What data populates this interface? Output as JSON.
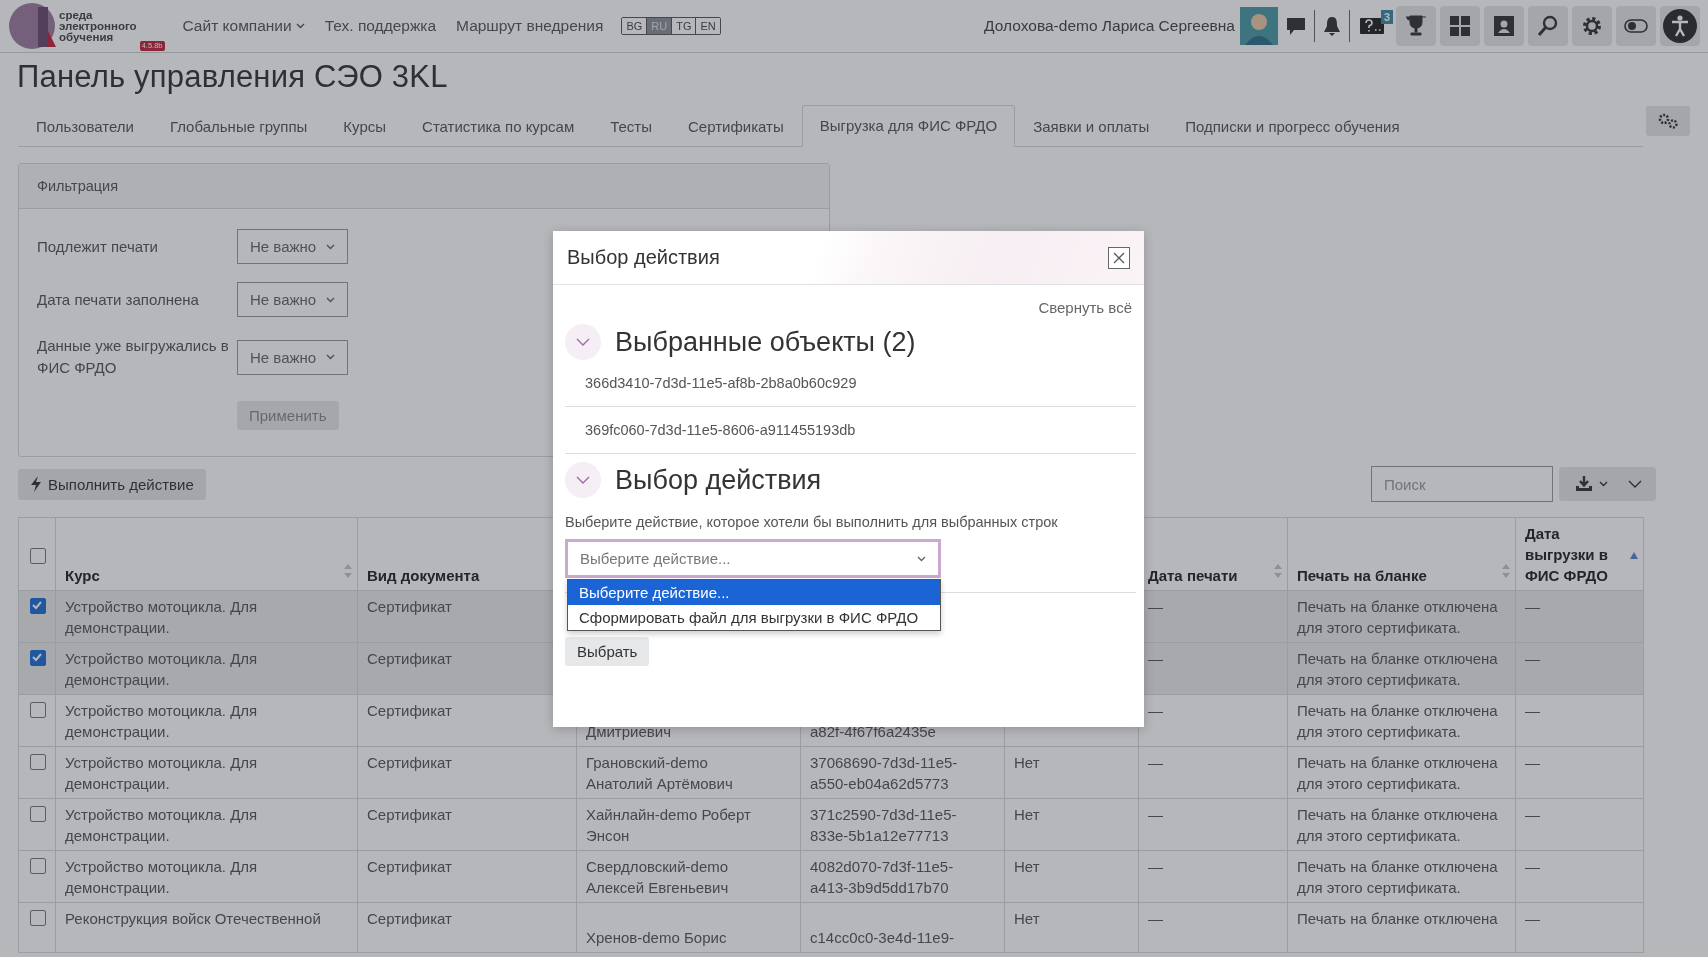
{
  "header": {
    "logo_lines": [
      "среда",
      "электронного",
      "обучения"
    ],
    "version": "4.5.8b",
    "nav": [
      {
        "label": "Сайт компании",
        "has_menu": true
      },
      {
        "label": "Тех. поддержка",
        "has_menu": false
      },
      {
        "label": "Маршрут внедрения",
        "has_menu": false
      }
    ],
    "languages": [
      {
        "label": "BG",
        "selected": false
      },
      {
        "label": "RU",
        "selected": true
      },
      {
        "label": "TG",
        "selected": false
      },
      {
        "label": "EN",
        "selected": false
      }
    ],
    "user_name": "Долохова-demo Лариса Сергеевна",
    "help_badge": "3"
  },
  "page_title": "Панель управления СЭО 3KL",
  "tabs": [
    {
      "label": "Пользователи",
      "selected": false
    },
    {
      "label": "Глобальные группы",
      "selected": false
    },
    {
      "label": "Курсы",
      "selected": false
    },
    {
      "label": "Статистика по курсам",
      "selected": false
    },
    {
      "label": "Тесты",
      "selected": false
    },
    {
      "label": "Сертификаты",
      "selected": false
    },
    {
      "label": "Выгрузка для ФИС ФРДО",
      "selected": true
    },
    {
      "label": "Заявки и оплаты",
      "selected": false
    },
    {
      "label": "Подписки и прогресс обучения",
      "selected": false
    }
  ],
  "filter": {
    "title": "Фильтрация",
    "fields": [
      {
        "label": "Подлежит печати",
        "value": "Не важно"
      },
      {
        "label": "Дата печати заполнена",
        "value": "Не важно"
      },
      {
        "label": "Данные уже выгружались в ФИС ФРДО",
        "value": "Не важно"
      }
    ],
    "apply": "Применить"
  },
  "toolbar": {
    "action": "Выполнить действие",
    "search_placeholder": "Поиск"
  },
  "table": {
    "select_all": {
      "checked": false
    },
    "columns": [
      {
        "label": "Курс",
        "sortable": true,
        "sorted": false
      },
      {
        "label": "Вид документа",
        "sortable": false
      },
      null,
      null,
      null,
      {
        "label": "Дата печати",
        "sortable": true,
        "sorted": false
      },
      {
        "label": "Печать на бланке",
        "sortable": true,
        "sorted": false
      },
      {
        "label": "Дата выгрузки в ФИС ФРДО",
        "sortable": true,
        "sorted": true
      }
    ],
    "rows": [
      {
        "checked": true,
        "cells": [
          "Устройство мотоцикла. Для демонстрации.",
          "Сертификат",
          null,
          null,
          null,
          "—",
          "Печать на бланке отключена для этого сертификата.",
          "—"
        ]
      },
      {
        "checked": true,
        "cells": [
          "Устройство мотоцикла. Для демонстрации.",
          "Сертификат",
          null,
          null,
          null,
          "—",
          "Печать на бланке отключена для этого сертификата.",
          "—"
        ]
      },
      {
        "checked": false,
        "cells": [
          "Устройство мотоцикла. Для демонстрации.",
          "Сертификат",
          "Дмитриевич",
          "a82f-4f67f6a2435e",
          null,
          "—",
          "Печать на бланке отключена для этого сертификата.",
          "—"
        ]
      },
      {
        "checked": false,
        "cells": [
          "Устройство мотоцикла. Для демонстрации.",
          "Сертификат",
          "Грановский-demo Анатолий Артёмович",
          "37068690-7d3d-11e5-a550-eb04a62d5773",
          "Нет",
          "—",
          "Печать на бланке отключена для этого сертификата.",
          "—"
        ]
      },
      {
        "checked": false,
        "cells": [
          "Устройство мотоцикла. Для демонстрации.",
          "Сертификат",
          "Хайнлайн-demo Роберт Энсон",
          "371c2590-7d3d-11e5-833e-5b1a12e77713",
          "Нет",
          "—",
          "Печать на бланке отключена для этого сертификата.",
          "—"
        ]
      },
      {
        "checked": false,
        "cells": [
          "Устройство мотоцикла. Для демонстрации.",
          "Сертификат",
          "Свердловский-demo Алексей Евгеньевич",
          "4082d070-7d3f-11e5-a413-3b9d5dd17b70",
          "Нет",
          "—",
          "Печать на бланке отключена для этого сертификата.",
          "—"
        ]
      },
      {
        "checked": false,
        "cells": [
          "Реконструкция войск Отечественной",
          "Сертификат",
          "Хренов-demo Борис",
          "c14cc0c0-3e4d-11e9-",
          "Нет",
          "—",
          "Печать на бланке отключена",
          "—"
        ]
      }
    ]
  },
  "modal": {
    "title": "Выбор действия",
    "collapse_all": "Свернуть всё",
    "sections": [
      {
        "title": "Выбранные объекты (2)",
        "expanded": true,
        "items": [
          "366d3410-7d3d-11e5-af8b-2b8a0b60c929",
          "369fc060-7d3d-11e5-8606-a911455193db"
        ]
      },
      {
        "title": "Выбор действия",
        "expanded": true,
        "description": "Выберите действие, которое хотели бы выполнить для выбранных строк",
        "select": {
          "placeholder": "Выберите действие...",
          "open": true,
          "options": [
            {
              "label": "Выберите действие...",
              "selected": true
            },
            {
              "label": "Сформировать файл для выгрузки в ФИС ФРДО",
              "selected": false
            }
          ]
        },
        "submit": "Выбрать"
      }
    ]
  }
}
